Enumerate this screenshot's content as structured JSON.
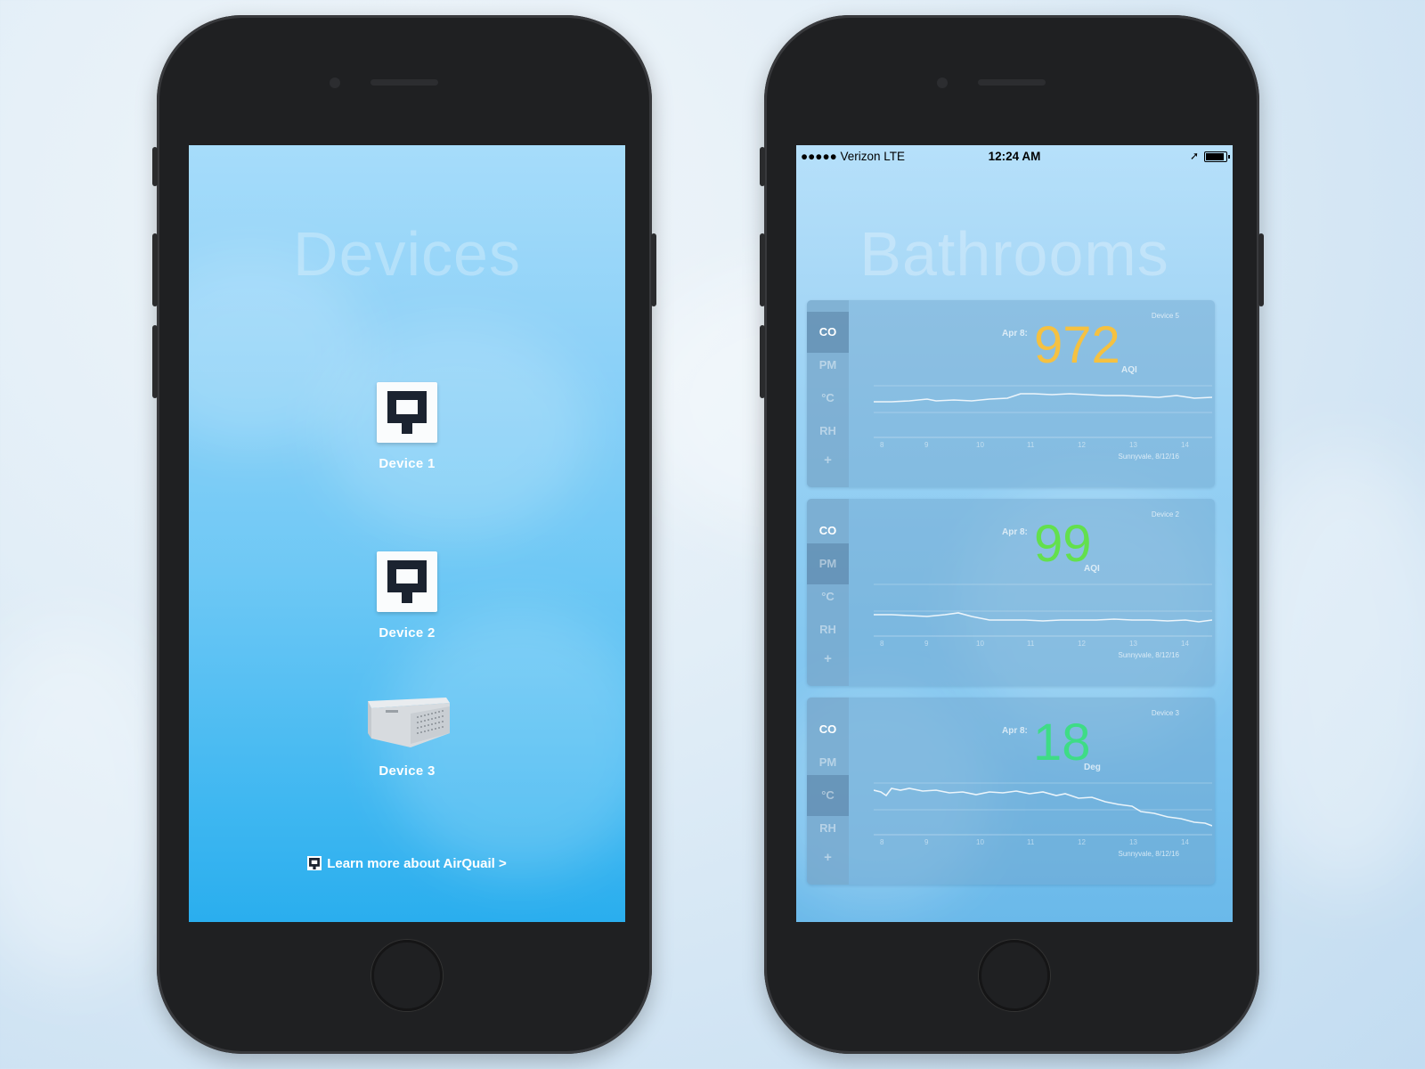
{
  "left_phone": {
    "title": "Devices",
    "devices": [
      {
        "label": "Device 1",
        "icon": "airquail-logo-icon"
      },
      {
        "label": "Device 2",
        "icon": "airquail-logo-icon"
      },
      {
        "label": "Device 3",
        "icon": "airquail-hardware-box-icon"
      }
    ],
    "learn_more": "Learn more about AirQuail >"
  },
  "right_phone": {
    "status_bar": {
      "carrier": "●●●●● Verizon  LTE",
      "time": "12:24 AM",
      "location_arrow": "➚"
    },
    "title": "Bathrooms",
    "tick_labels": [
      "8",
      "9",
      "10",
      "11",
      "12",
      "13",
      "14"
    ],
    "cards": [
      {
        "device": "Device 5",
        "tabs": [
          "CO",
          "PM",
          "°C",
          "RH",
          "+"
        ],
        "active_tab": "CO",
        "date": "Apr 8:",
        "value": "972",
        "unit": "AQI",
        "value_color": "#f5c141",
        "location": "Sunnyvale, 8/12/16"
      },
      {
        "device": "Device 2",
        "tabs": [
          "CO",
          "PM",
          "°C",
          "RH",
          "+"
        ],
        "active_tab": "PM",
        "date": "Apr 8:",
        "value": "99",
        "unit": "AQI",
        "value_color": "#63e04d",
        "location": "Sunnyvale, 8/12/16"
      },
      {
        "device": "Device 3",
        "tabs": [
          "CO",
          "PM",
          "°C",
          "RH",
          "+"
        ],
        "active_tab": "°C",
        "date": "Apr 8:",
        "value": "18",
        "unit": "Deg",
        "value_color": "#3edc86",
        "location": "Sunnyvale, 8/12/16"
      }
    ]
  }
}
